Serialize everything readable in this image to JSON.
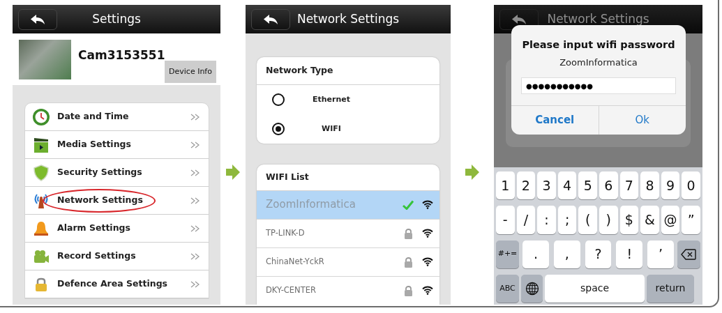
{
  "settings_screen": {
    "title": "Settings",
    "camera": {
      "name": "Cam3153551",
      "info_button": "Device Info"
    },
    "items": [
      {
        "label": "Date and Time",
        "highlighted": false
      },
      {
        "label": "Media Settings",
        "highlighted": false
      },
      {
        "label": "Security Settings",
        "highlighted": false
      },
      {
        "label": "Network Settings",
        "highlighted": true
      },
      {
        "label": "Alarm Settings",
        "highlighted": false
      },
      {
        "label": "Record Settings",
        "highlighted": false
      },
      {
        "label": "Defence Area Settings",
        "highlighted": false
      }
    ]
  },
  "network_screen": {
    "title": "Network Settings",
    "network_type": {
      "heading": "Network Type",
      "options": [
        {
          "label": "Ethernet",
          "selected": false
        },
        {
          "label": "WIFI",
          "selected": true
        }
      ]
    },
    "wifi_list": {
      "heading": "WIFI List",
      "networks": [
        {
          "name": "ZoomInformatica",
          "selected": true,
          "locked": false
        },
        {
          "name": "TP-LINK-D",
          "selected": false,
          "locked": true
        },
        {
          "name": "ChinaNet-YckR",
          "selected": false,
          "locked": true
        },
        {
          "name": "DKY-CENTER",
          "selected": false,
          "locked": true
        }
      ]
    }
  },
  "password_screen": {
    "title": "Network Settings",
    "dialog": {
      "title": "Please input wifi password",
      "subtitle": "ZoomInformatica",
      "password": "●●●●●●●●●●●",
      "buttons": [
        "Cancel",
        "Ok"
      ]
    },
    "keyboard": {
      "rows": [
        {
          "keys": [
            {
              "kind": "char",
              "label": "1"
            },
            {
              "kind": "char",
              "label": "2"
            },
            {
              "kind": "char",
              "label": "3"
            },
            {
              "kind": "char",
              "label": "4"
            },
            {
              "kind": "char",
              "label": "5"
            },
            {
              "kind": "char",
              "label": "6"
            },
            {
              "kind": "char",
              "label": "7"
            },
            {
              "kind": "char",
              "label": "8"
            },
            {
              "kind": "char",
              "label": "9"
            },
            {
              "kind": "char",
              "label": "0"
            }
          ]
        },
        {
          "keys": [
            {
              "kind": "char",
              "label": "-"
            },
            {
              "kind": "char",
              "label": "/"
            },
            {
              "kind": "char",
              "label": ":"
            },
            {
              "kind": "char",
              "label": ";"
            },
            {
              "kind": "char",
              "label": "("
            },
            {
              "kind": "char",
              "label": ")"
            },
            {
              "kind": "char",
              "label": "$"
            },
            {
              "kind": "char",
              "label": "&"
            },
            {
              "kind": "char",
              "label": "@"
            },
            {
              "kind": "char",
              "label": "”"
            }
          ]
        },
        {
          "keys": [
            {
              "kind": "function",
              "label": "#+="
            },
            {
              "kind": "wide",
              "label": "."
            },
            {
              "kind": "wide",
              "label": ","
            },
            {
              "kind": "wide",
              "label": "?"
            },
            {
              "kind": "wide",
              "label": "!"
            },
            {
              "kind": "wide",
              "label": "’"
            },
            {
              "kind": "backspace"
            }
          ]
        },
        {
          "keys": [
            {
              "kind": "function",
              "label": "ABC"
            },
            {
              "kind": "globe"
            },
            {
              "kind": "space",
              "label": "space"
            },
            {
              "kind": "return",
              "label": "return"
            }
          ]
        }
      ]
    }
  }
}
